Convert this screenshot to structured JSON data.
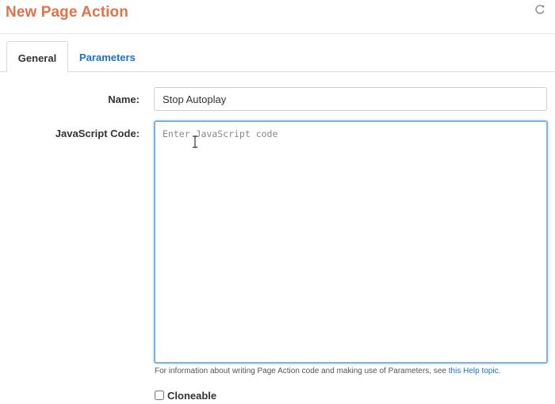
{
  "header": {
    "title": "New Page Action",
    "refresh_icon": "refresh-icon"
  },
  "tabs": [
    {
      "label": "General",
      "active": true
    },
    {
      "label": "Parameters",
      "active": false
    }
  ],
  "form": {
    "name_label": "Name:",
    "name_value": "Stop Autoplay",
    "code_label": "JavaScript Code:",
    "code_placeholder": "Enter JavaScript code",
    "help_text": "For information about writing Page Action code and making use of Parameters, see ",
    "help_link": "this Help topic",
    "help_suffix": ".",
    "cloneable_label": "Cloneable",
    "cloneable_checked": false
  },
  "colors": {
    "title": "#e0734a",
    "link": "#1a73c8",
    "focus_border": "#7fb3dc"
  }
}
